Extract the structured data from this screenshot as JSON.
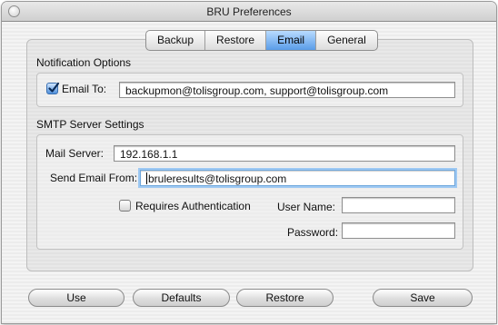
{
  "window": {
    "title": "BRU Preferences"
  },
  "tabs": [
    {
      "label": "Backup",
      "active": false
    },
    {
      "label": "Restore",
      "active": false
    },
    {
      "label": "Email",
      "active": true
    },
    {
      "label": "General",
      "active": false
    }
  ],
  "notification": {
    "title": "Notification Options",
    "email_to_checked": true,
    "email_to_label": "Email To:",
    "email_to_value": "backupmon@tolisgroup.com, support@tolisgroup.com"
  },
  "smtp": {
    "title": "SMTP Server Settings",
    "mail_server_label": "Mail Server:",
    "mail_server_value": "192.168.1.1",
    "send_from_label": "Send Email From:",
    "send_from_value": "bruleresults@tolisgroup.com",
    "requires_auth_label": "Requires Authentication",
    "requires_auth_checked": false,
    "user_name_label": "User Name:",
    "user_name_value": "",
    "password_label": "Password:",
    "password_value": ""
  },
  "buttons": {
    "use": "Use",
    "defaults": "Defaults",
    "restore": "Restore",
    "save": "Save"
  },
  "colors": {
    "tab_active": "#5a9ce8",
    "focus_ring": "#9ec9f3",
    "checkbox_checked": "#4f8fdb"
  }
}
